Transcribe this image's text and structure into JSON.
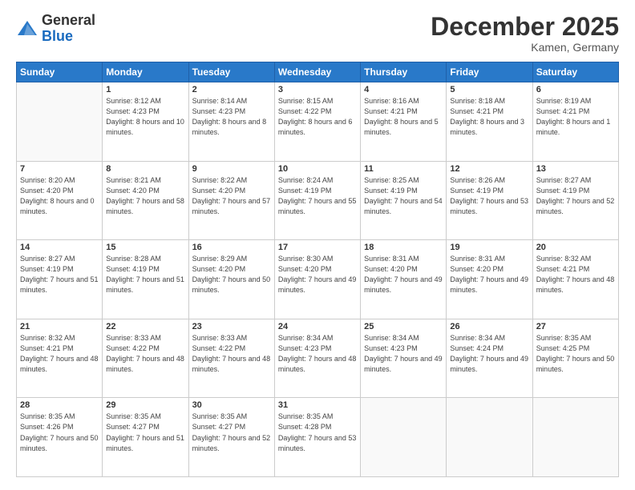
{
  "header": {
    "logo_general": "General",
    "logo_blue": "Blue",
    "month_title": "December 2025",
    "location": "Kamen, Germany"
  },
  "weekdays": [
    "Sunday",
    "Monday",
    "Tuesday",
    "Wednesday",
    "Thursday",
    "Friday",
    "Saturday"
  ],
  "weeks": [
    [
      {
        "day": "",
        "info": ""
      },
      {
        "day": "1",
        "info": "Sunrise: 8:12 AM\nSunset: 4:23 PM\nDaylight: 8 hours\nand 10 minutes."
      },
      {
        "day": "2",
        "info": "Sunrise: 8:14 AM\nSunset: 4:23 PM\nDaylight: 8 hours\nand 8 minutes."
      },
      {
        "day": "3",
        "info": "Sunrise: 8:15 AM\nSunset: 4:22 PM\nDaylight: 8 hours\nand 6 minutes."
      },
      {
        "day": "4",
        "info": "Sunrise: 8:16 AM\nSunset: 4:21 PM\nDaylight: 8 hours\nand 5 minutes."
      },
      {
        "day": "5",
        "info": "Sunrise: 8:18 AM\nSunset: 4:21 PM\nDaylight: 8 hours\nand 3 minutes."
      },
      {
        "day": "6",
        "info": "Sunrise: 8:19 AM\nSunset: 4:21 PM\nDaylight: 8 hours\nand 1 minute."
      }
    ],
    [
      {
        "day": "7",
        "info": "Sunrise: 8:20 AM\nSunset: 4:20 PM\nDaylight: 8 hours\nand 0 minutes."
      },
      {
        "day": "8",
        "info": "Sunrise: 8:21 AM\nSunset: 4:20 PM\nDaylight: 7 hours\nand 58 minutes."
      },
      {
        "day": "9",
        "info": "Sunrise: 8:22 AM\nSunset: 4:20 PM\nDaylight: 7 hours\nand 57 minutes."
      },
      {
        "day": "10",
        "info": "Sunrise: 8:24 AM\nSunset: 4:19 PM\nDaylight: 7 hours\nand 55 minutes."
      },
      {
        "day": "11",
        "info": "Sunrise: 8:25 AM\nSunset: 4:19 PM\nDaylight: 7 hours\nand 54 minutes."
      },
      {
        "day": "12",
        "info": "Sunrise: 8:26 AM\nSunset: 4:19 PM\nDaylight: 7 hours\nand 53 minutes."
      },
      {
        "day": "13",
        "info": "Sunrise: 8:27 AM\nSunset: 4:19 PM\nDaylight: 7 hours\nand 52 minutes."
      }
    ],
    [
      {
        "day": "14",
        "info": "Sunrise: 8:27 AM\nSunset: 4:19 PM\nDaylight: 7 hours\nand 51 minutes."
      },
      {
        "day": "15",
        "info": "Sunrise: 8:28 AM\nSunset: 4:19 PM\nDaylight: 7 hours\nand 51 minutes."
      },
      {
        "day": "16",
        "info": "Sunrise: 8:29 AM\nSunset: 4:20 PM\nDaylight: 7 hours\nand 50 minutes."
      },
      {
        "day": "17",
        "info": "Sunrise: 8:30 AM\nSunset: 4:20 PM\nDaylight: 7 hours\nand 49 minutes."
      },
      {
        "day": "18",
        "info": "Sunrise: 8:31 AM\nSunset: 4:20 PM\nDaylight: 7 hours\nand 49 minutes."
      },
      {
        "day": "19",
        "info": "Sunrise: 8:31 AM\nSunset: 4:20 PM\nDaylight: 7 hours\nand 49 minutes."
      },
      {
        "day": "20",
        "info": "Sunrise: 8:32 AM\nSunset: 4:21 PM\nDaylight: 7 hours\nand 48 minutes."
      }
    ],
    [
      {
        "day": "21",
        "info": "Sunrise: 8:32 AM\nSunset: 4:21 PM\nDaylight: 7 hours\nand 48 minutes."
      },
      {
        "day": "22",
        "info": "Sunrise: 8:33 AM\nSunset: 4:22 PM\nDaylight: 7 hours\nand 48 minutes."
      },
      {
        "day": "23",
        "info": "Sunrise: 8:33 AM\nSunset: 4:22 PM\nDaylight: 7 hours\nand 48 minutes."
      },
      {
        "day": "24",
        "info": "Sunrise: 8:34 AM\nSunset: 4:23 PM\nDaylight: 7 hours\nand 48 minutes."
      },
      {
        "day": "25",
        "info": "Sunrise: 8:34 AM\nSunset: 4:23 PM\nDaylight: 7 hours\nand 49 minutes."
      },
      {
        "day": "26",
        "info": "Sunrise: 8:34 AM\nSunset: 4:24 PM\nDaylight: 7 hours\nand 49 minutes."
      },
      {
        "day": "27",
        "info": "Sunrise: 8:35 AM\nSunset: 4:25 PM\nDaylight: 7 hours\nand 50 minutes."
      }
    ],
    [
      {
        "day": "28",
        "info": "Sunrise: 8:35 AM\nSunset: 4:26 PM\nDaylight: 7 hours\nand 50 minutes."
      },
      {
        "day": "29",
        "info": "Sunrise: 8:35 AM\nSunset: 4:27 PM\nDaylight: 7 hours\nand 51 minutes."
      },
      {
        "day": "30",
        "info": "Sunrise: 8:35 AM\nSunset: 4:27 PM\nDaylight: 7 hours\nand 52 minutes."
      },
      {
        "day": "31",
        "info": "Sunrise: 8:35 AM\nSunset: 4:28 PM\nDaylight: 7 hours\nand 53 minutes."
      },
      {
        "day": "",
        "info": ""
      },
      {
        "day": "",
        "info": ""
      },
      {
        "day": "",
        "info": ""
      }
    ]
  ]
}
